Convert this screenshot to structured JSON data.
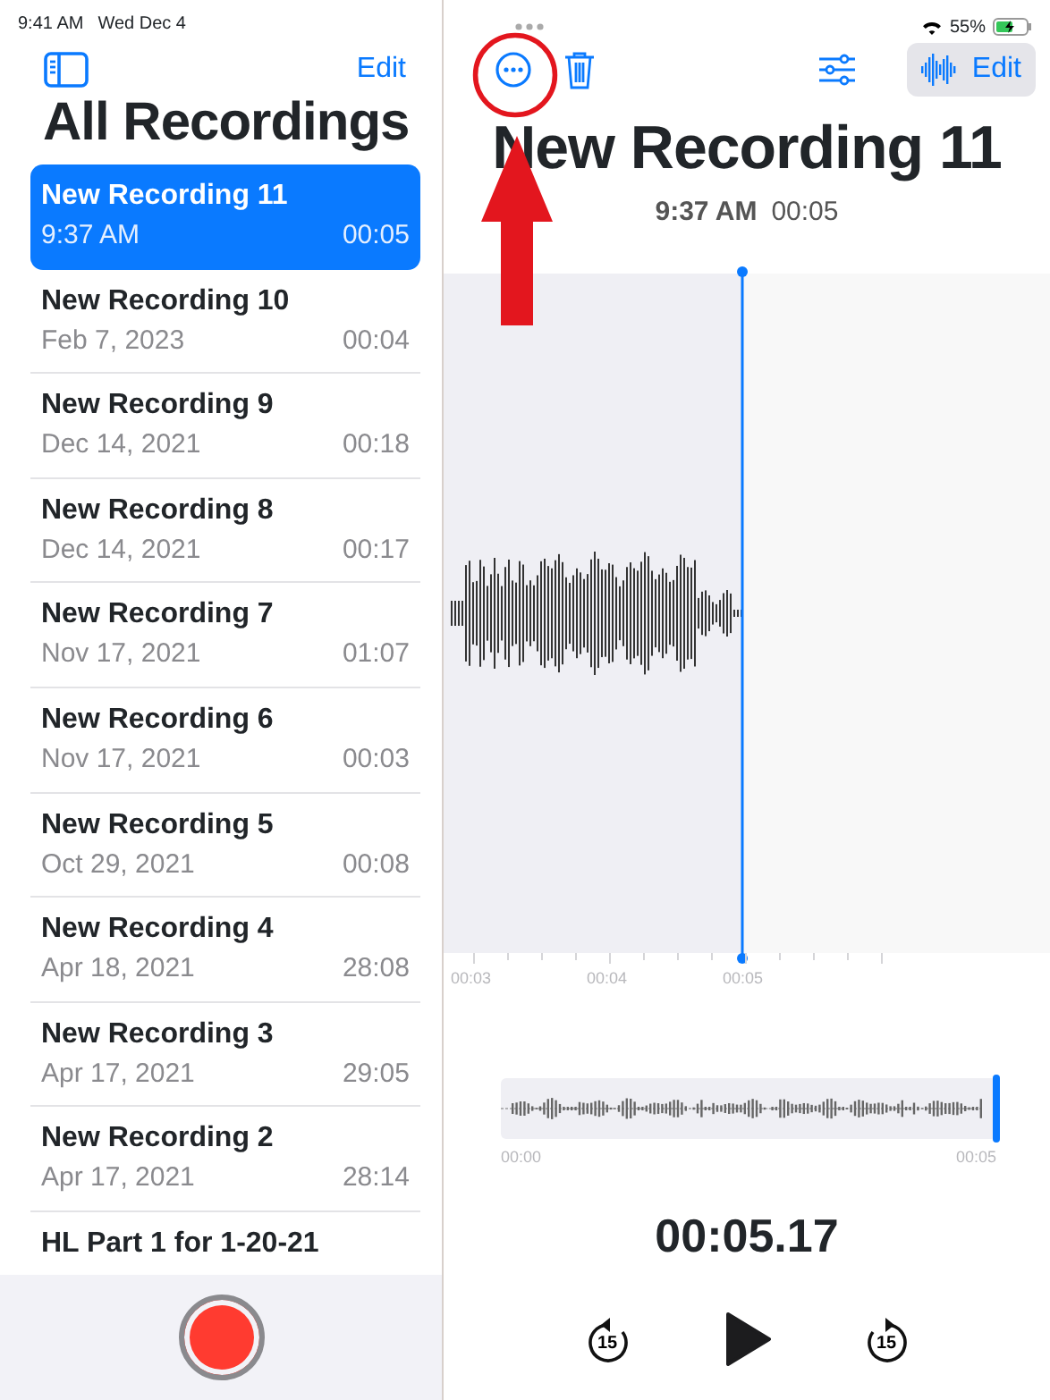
{
  "status_bar": {
    "time": "9:41 AM",
    "date": "Wed Dec 4",
    "battery": "55%"
  },
  "sidebar": {
    "edit": "Edit",
    "title": "All Recordings",
    "recordings": [
      {
        "title": "New Recording 11",
        "date": "9:37 AM",
        "duration": "00:05",
        "selected": true
      },
      {
        "title": "New Recording 10",
        "date": "Feb 7, 2023",
        "duration": "00:04",
        "selected": false
      },
      {
        "title": "New Recording 9",
        "date": "Dec 14, 2021",
        "duration": "00:18",
        "selected": false
      },
      {
        "title": "New Recording 8",
        "date": "Dec 14, 2021",
        "duration": "00:17",
        "selected": false
      },
      {
        "title": "New Recording 7",
        "date": "Nov 17, 2021",
        "duration": "01:07",
        "selected": false
      },
      {
        "title": "New Recording 6",
        "date": "Nov 17, 2021",
        "duration": "00:03",
        "selected": false
      },
      {
        "title": "New Recording 5",
        "date": "Oct 29, 2021",
        "duration": "00:08",
        "selected": false
      },
      {
        "title": "New Recording 4",
        "date": "Apr 18, 2021",
        "duration": "28:08",
        "selected": false
      },
      {
        "title": "New Recording 3",
        "date": "Apr 17, 2021",
        "duration": "29:05",
        "selected": false
      },
      {
        "title": "New Recording 2",
        "date": "Apr 17, 2021",
        "duration": "28:14",
        "selected": false
      },
      {
        "title": "HL Part 1 for 1-20-21",
        "selected": false
      }
    ]
  },
  "detail": {
    "edit": "Edit",
    "title": "New Recording 11",
    "time": "9:37 AM",
    "duration": "00:05",
    "timeline_ticks": [
      "00:03",
      "00:04",
      "00:05"
    ],
    "overview": {
      "start": "00:00",
      "end": "00:05",
      "level": 1
    },
    "timer": "00:05.17",
    "skip_back": "15",
    "skip_forward": "15"
  }
}
